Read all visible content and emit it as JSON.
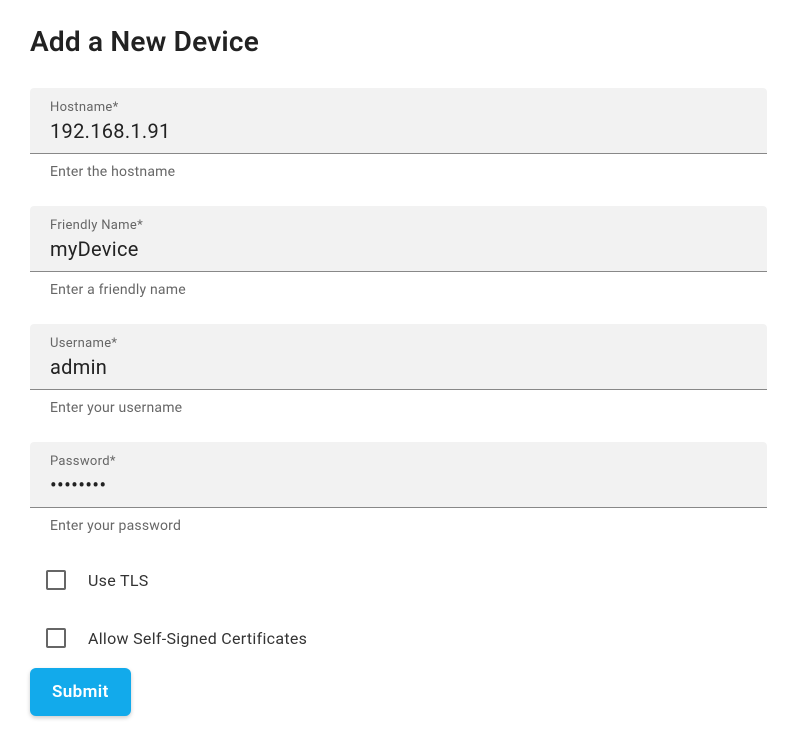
{
  "title": "Add a New Device",
  "fields": {
    "hostname": {
      "label": "Hostname*",
      "value": "192.168.1.91",
      "helper": "Enter the hostname"
    },
    "friendly_name": {
      "label": "Friendly Name*",
      "value": "myDevice",
      "helper": "Enter a friendly name"
    },
    "username": {
      "label": "Username*",
      "value": "admin",
      "helper": "Enter your username"
    },
    "password": {
      "label": "Password*",
      "value": "••••••••",
      "helper": "Enter your password"
    }
  },
  "checkboxes": {
    "use_tls": {
      "label": "Use TLS",
      "checked": false
    },
    "allow_self_signed": {
      "label": "Allow Self-Signed Certificates",
      "checked": false
    }
  },
  "submit_label": "Submit"
}
